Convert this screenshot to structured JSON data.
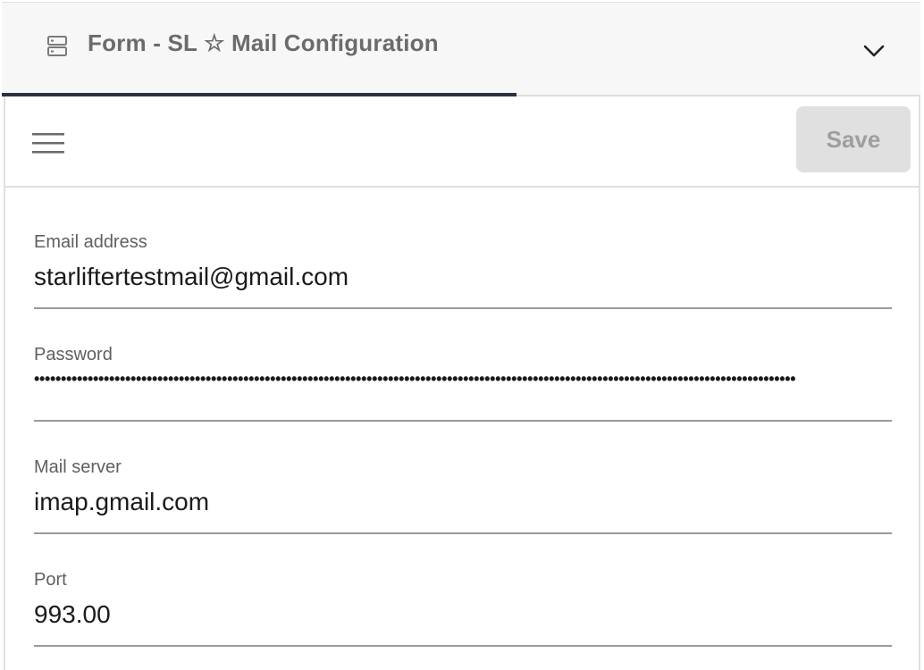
{
  "tab": {
    "title": "Form - SL ☆ Mail Configuration",
    "icon": "server-icon",
    "expand_icon": "chevron-down-icon"
  },
  "toolbar": {
    "menu_icon": "hamburger-menu-icon",
    "save_label": "Save"
  },
  "form": {
    "email": {
      "label": "Email address",
      "value": "starliftertestmail@gmail.com"
    },
    "password": {
      "label": "Password",
      "value": "••••••••••••••••••••••••••••••••••••••••••••••••••••••••••••••••••••••••••••••••••••••••••••••••••••••••••••••••••••••••••••••••••••••••••••••"
    },
    "mail_server": {
      "label": "Mail server",
      "value": "imap.gmail.com"
    },
    "port": {
      "label": "Port",
      "value": "993.00"
    }
  },
  "colors": {
    "tab_indicator": "#2c3142",
    "save_disabled_bg": "#e0e0e0",
    "save_disabled_text": "#9e9e9e"
  }
}
